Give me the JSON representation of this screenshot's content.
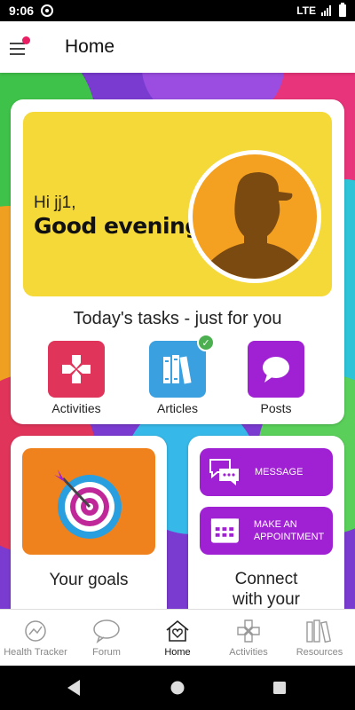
{
  "status_bar": {
    "time": "9:06",
    "network": "LTE"
  },
  "app_bar": {
    "title": "Home"
  },
  "greeting": {
    "hi": "Hi jj1,",
    "message": "Good evening"
  },
  "tasks": {
    "title": "Today's tasks - just for you",
    "items": [
      {
        "label": "Activities",
        "color": "#e0345a",
        "icon": "gamepad-icon",
        "completed": false
      },
      {
        "label": "Articles",
        "color": "#3ba0e0",
        "icon": "books-icon",
        "completed": true
      },
      {
        "label": "Posts",
        "color": "#a020d4",
        "icon": "speech-bubble-icon",
        "completed": false
      }
    ]
  },
  "goals": {
    "label": "Your goals",
    "icon": "target-icon"
  },
  "connect": {
    "message_label": "MESSAGE",
    "appointment_label": "MAKE AN APPOINTMENT",
    "label": "Connect with your"
  },
  "bottom_nav": [
    {
      "label": "Health Tracker",
      "icon": "health-tracker-icon",
      "active": false
    },
    {
      "label": "Forum",
      "icon": "forum-icon",
      "active": false
    },
    {
      "label": "Home",
      "icon": "home-heart-icon",
      "active": true
    },
    {
      "label": "Activities",
      "icon": "activities-icon",
      "active": false
    },
    {
      "label": "Resources",
      "icon": "resources-icon",
      "active": false
    }
  ],
  "colors": {
    "accent_yellow": "#f5d938",
    "accent_orange": "#f0821e",
    "accent_purple": "#a020d4",
    "notification_dot": "#e91e63",
    "check_green": "#4caf50"
  }
}
